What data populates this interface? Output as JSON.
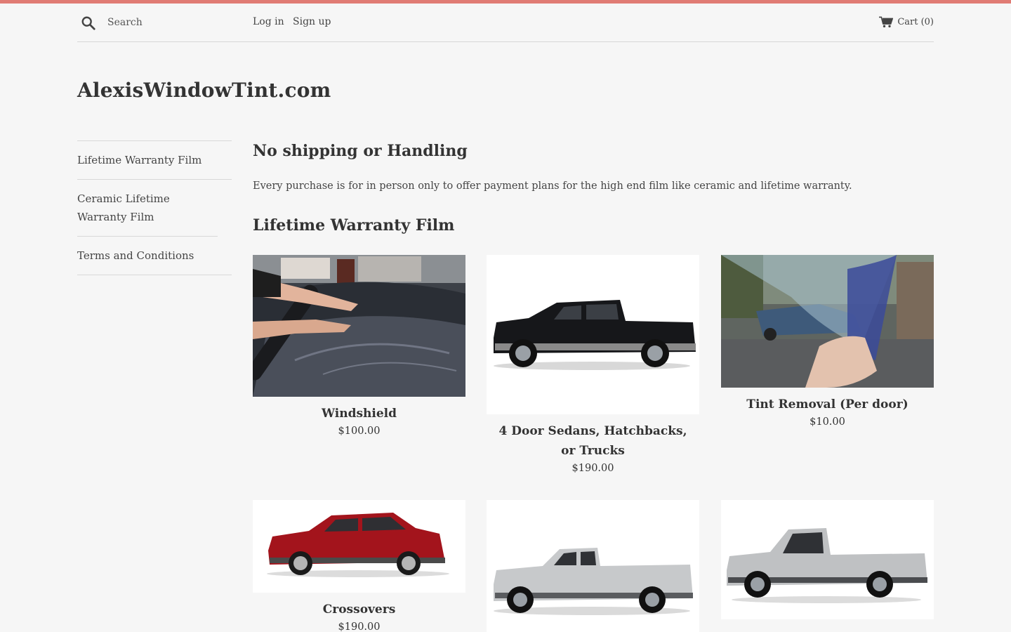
{
  "header": {
    "search_placeholder": "Search",
    "login": "Log in",
    "signup": "Sign up",
    "cart": "Cart (0)"
  },
  "site": {
    "title": "AlexisWindowTint.com"
  },
  "sidebar": {
    "items": [
      {
        "label": "Lifetime Warranty Film"
      },
      {
        "label": "Ceramic Lifetime Warranty Film"
      },
      {
        "label": "Terms and Conditions"
      }
    ]
  },
  "main": {
    "heading": "No shipping or Handling",
    "intro": "Every purchase is for in person only to offer payment plans for the high end film like ceramic and lifetime warranty.",
    "collection_heading": "Lifetime Warranty Film"
  },
  "products": [
    {
      "title": "Windshield",
      "price": "$100.00"
    },
    {
      "title": "4 Door Sedans, Hatchbacks, or Trucks",
      "price": "$190.00"
    },
    {
      "title": "Tint Removal (Per door)",
      "price": "$10.00"
    },
    {
      "title": "Crossovers",
      "price": "$190.00"
    },
    {
      "title": "",
      "price": ""
    },
    {
      "title": "",
      "price": ""
    }
  ],
  "colors": {
    "accent_bar": "#e07b74",
    "background": "#f6f6f6",
    "text": "#333333"
  }
}
